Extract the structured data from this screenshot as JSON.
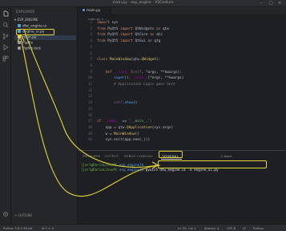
{
  "window": {
    "title": "main.py - esp_engine - VSCodium",
    "controls": [
      "–",
      "□",
      "✕"
    ]
  },
  "sidebar": {
    "header": "EXPLORER",
    "folder": "ESP_ENGINE",
    "files": [
      {
        "label": "dtw_engine.ui",
        "color": "#4fa3d8"
      },
      {
        "label": "engine_ui.py",
        "color": "#4fa3d8",
        "selected": true
      },
      {
        "label": "main.py",
        "color": "#e0c46c"
      },
      {
        "label": "Pipfile",
        "color": "#9a9a9a"
      },
      {
        "label": "Pipfile.lock",
        "color": "#9a9a9a"
      }
    ],
    "outline": "> OUTLINE"
  },
  "editor": {
    "tab": "main.py",
    "breadcrumb": "main.py > ...",
    "lines": [
      {
        "n": "1",
        "parts": [
          [
            "kw",
            "import "
          ],
          [
            "tx",
            "sys"
          ]
        ]
      },
      {
        "n": "2",
        "parts": [
          [
            "kw",
            "from "
          ],
          [
            "tx",
            "PyQt5 "
          ],
          [
            "kw",
            "import "
          ],
          [
            "tx",
            "QtWidgets "
          ],
          [
            "kw",
            "as "
          ],
          [
            "tx",
            "qtw"
          ]
        ]
      },
      {
        "n": "3",
        "parts": [
          [
            "kw",
            "from "
          ],
          [
            "tx",
            "PyQt5 "
          ],
          [
            "kw",
            "import "
          ],
          [
            "tx",
            "QtCore "
          ],
          [
            "kw",
            "as "
          ],
          [
            "tx",
            "qtc"
          ]
        ]
      },
      {
        "n": "4",
        "parts": [
          [
            "kw",
            "from "
          ],
          [
            "tx",
            "PyQt5 "
          ],
          [
            "kw",
            "import "
          ],
          [
            "tx",
            "QtGui "
          ],
          [
            "kw",
            "as "
          ],
          [
            "tx",
            "qtg"
          ]
        ]
      },
      {
        "n": "5",
        "parts": []
      },
      {
        "n": "6",
        "parts": []
      },
      {
        "n": "7",
        "parts": [
          [
            "kw",
            "class "
          ],
          [
            "cls",
            "MainWindow"
          ],
          [
            "tx",
            "(qtw."
          ],
          [
            "cls",
            "QWidget"
          ],
          [
            "tx",
            "):"
          ]
        ]
      },
      {
        "n": "8",
        "parts": []
      },
      {
        "n": "9",
        "parts": [
          [
            "tx",
            "    "
          ],
          [
            "kw",
            "def "
          ],
          [
            "mag",
            "__init__"
          ],
          [
            "tx",
            "("
          ],
          [
            "self",
            "self"
          ],
          [
            "tx",
            ", *args, **kwargs):"
          ]
        ]
      },
      {
        "n": "10",
        "parts": [
          [
            "tx",
            "        "
          ],
          [
            "fn",
            "super"
          ],
          [
            "tx",
            "()."
          ],
          [
            "mag",
            "__init__"
          ],
          [
            "tx",
            "(*args, **kwargs)"
          ]
        ]
      },
      {
        "n": "11",
        "parts": [
          [
            "cm",
            "        # Application Logic goes here"
          ]
        ]
      },
      {
        "n": "12",
        "parts": []
      },
      {
        "n": "13",
        "parts": []
      },
      {
        "n": "14",
        "parts": [
          [
            "tx",
            "        "
          ],
          [
            "self",
            "self"
          ],
          [
            "tx",
            "."
          ],
          [
            "fn",
            "show"
          ],
          [
            "tx",
            "()"
          ]
        ]
      },
      {
        "n": "15",
        "parts": []
      },
      {
        "n": "16",
        "parts": []
      },
      {
        "n": "17",
        "parts": [
          [
            "kw",
            "if "
          ],
          [
            "mag",
            "__name__"
          ],
          [
            "tx",
            " == "
          ],
          [
            "str",
            "'__main__'"
          ],
          [
            "tx",
            ":"
          ]
        ]
      },
      {
        "n": "18",
        "parts": [
          [
            "tx",
            "    app = qtw."
          ],
          [
            "cls",
            "QApplication"
          ],
          [
            "tx",
            "(sys.argv)"
          ]
        ]
      },
      {
        "n": "19",
        "parts": [
          [
            "tx",
            "    w = "
          ],
          [
            "cls",
            "MainWindow"
          ],
          [
            "tx",
            "()"
          ]
        ]
      },
      {
        "n": "20",
        "parts": [
          [
            "tx",
            "    sys.exit(app.exec_())"
          ]
        ]
      }
    ]
  },
  "panel": {
    "tabs": [
      "PROBLEMS",
      "OUTPUT",
      "DEBUG CONSOLE",
      "TERMINAL"
    ],
    "active_tab": "TERMINAL",
    "shell": "1: bash",
    "terminal": [
      {
        "prompt": "[jarl@DarioLinuxPC",
        "path": "esp_engine]$",
        "cmd": ""
      },
      {
        "prompt": "[jarl@DarioLinuxPC",
        "path": "esp_engine]$",
        "cmd": " pyuic5 dtw_engine.ui -o engine_ui.py"
      }
    ]
  },
  "status": {
    "left": "Python 3.8.2 64-bit",
    "errors": "⊗ 0 ⚠ 0",
    "position": "Ln 20, Col 1",
    "spaces": "Spaces: 4",
    "encoding": "UTF-8",
    "eol": "LF",
    "lang": "Python"
  },
  "accent": "#e4d53a"
}
